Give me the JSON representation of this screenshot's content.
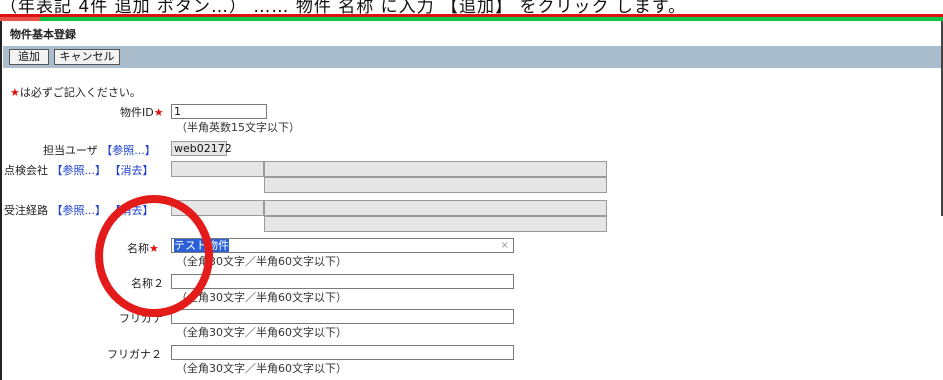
{
  "caption": {
    "text": "（年表記 4件 追加 ボタン…） …… 物件 名称 に入力 【追加】 をクリック します。"
  },
  "page": {
    "title": "物件基本登録"
  },
  "toolbar": {
    "add_label": "追加",
    "cancel_label": "キャンセル"
  },
  "required_note": "は必ずご記入ください。",
  "star": "★",
  "fields": {
    "property_id": {
      "label": "物件ID",
      "value": "1",
      "hint": "（半角英数15文字以下）"
    },
    "user": {
      "label": "担当ユーザ",
      "link": "【参照...】",
      "value": "web02172"
    },
    "inspection": {
      "label": "点検会社",
      "ref_link": "【参照...】",
      "clear_link": "【消去】"
    },
    "route": {
      "label": "受注経路",
      "ref_link": "【参照...】",
      "clear_link": "【消去】"
    },
    "name": {
      "label": "名称",
      "value": "テスト物件",
      "clear": "×",
      "hint": "（全角30文字／半角60文字以下）"
    },
    "name2": {
      "label": "名称２",
      "value": "",
      "hint": "（全角30文字／半角60文字以下）"
    },
    "kana": {
      "label": "フリガナ",
      "value": "",
      "hint": "（全角30文字／半角60文字以下）"
    },
    "kana2": {
      "label": "フリガナ２",
      "value": "",
      "hint": "（全角30文字／半角60文字以下）"
    }
  },
  "colors": {
    "accent_red": "#e01010",
    "link_blue": "#1a3ecf",
    "toolbar_bg": "#a9bdcc",
    "highlight_circle": "#e31b1b"
  }
}
